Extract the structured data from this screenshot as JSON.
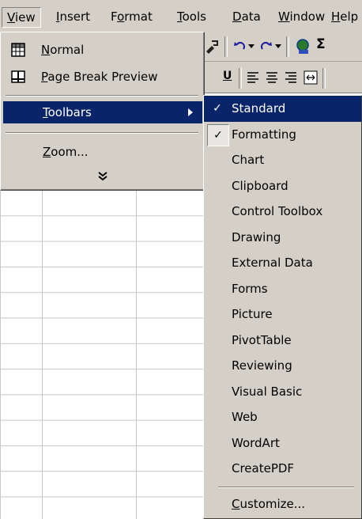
{
  "menubar": {
    "items": [
      {
        "label": "View"
      },
      {
        "label": "Insert"
      },
      {
        "label": "Format"
      },
      {
        "label": "Tools"
      },
      {
        "label": "Data"
      },
      {
        "label": "Window"
      },
      {
        "label": "Help"
      }
    ]
  },
  "view_menu": {
    "normal": "Normal",
    "page_break_preview": "Page Break Preview",
    "toolbars": "Toolbars",
    "zoom": "Zoom...",
    "expand_glyph": "»"
  },
  "toolbars_submenu": {
    "items": [
      {
        "label": "Standard",
        "checked": true
      },
      {
        "label": "Formatting",
        "checked": true
      },
      {
        "label": "Chart",
        "checked": false
      },
      {
        "label": "Clipboard",
        "checked": false
      },
      {
        "label": "Control Toolbox",
        "checked": false
      },
      {
        "label": "Drawing",
        "checked": false
      },
      {
        "label": "External Data",
        "checked": false
      },
      {
        "label": "Forms",
        "checked": false
      },
      {
        "label": "Picture",
        "checked": false
      },
      {
        "label": "PivotTable",
        "checked": false
      },
      {
        "label": "Reviewing",
        "checked": false
      },
      {
        "label": "Visual Basic",
        "checked": false
      },
      {
        "label": "Web",
        "checked": false
      },
      {
        "label": "WordArt",
        "checked": false
      },
      {
        "label": "CreatePDF",
        "checked": false
      }
    ],
    "customize": "Customize...",
    "check_glyph": "✓"
  },
  "colors": {
    "menu_face": "#d4d0c8",
    "highlight": "#0a246a",
    "highlight_text": "#ffffff",
    "grid_line": "#c8c8c8"
  },
  "icons": {
    "normal": "grid-view-icon",
    "page_break_preview": "page-break-preview-icon",
    "submenu": "triangle-right-icon",
    "expand": "double-chevron-down-icon"
  }
}
